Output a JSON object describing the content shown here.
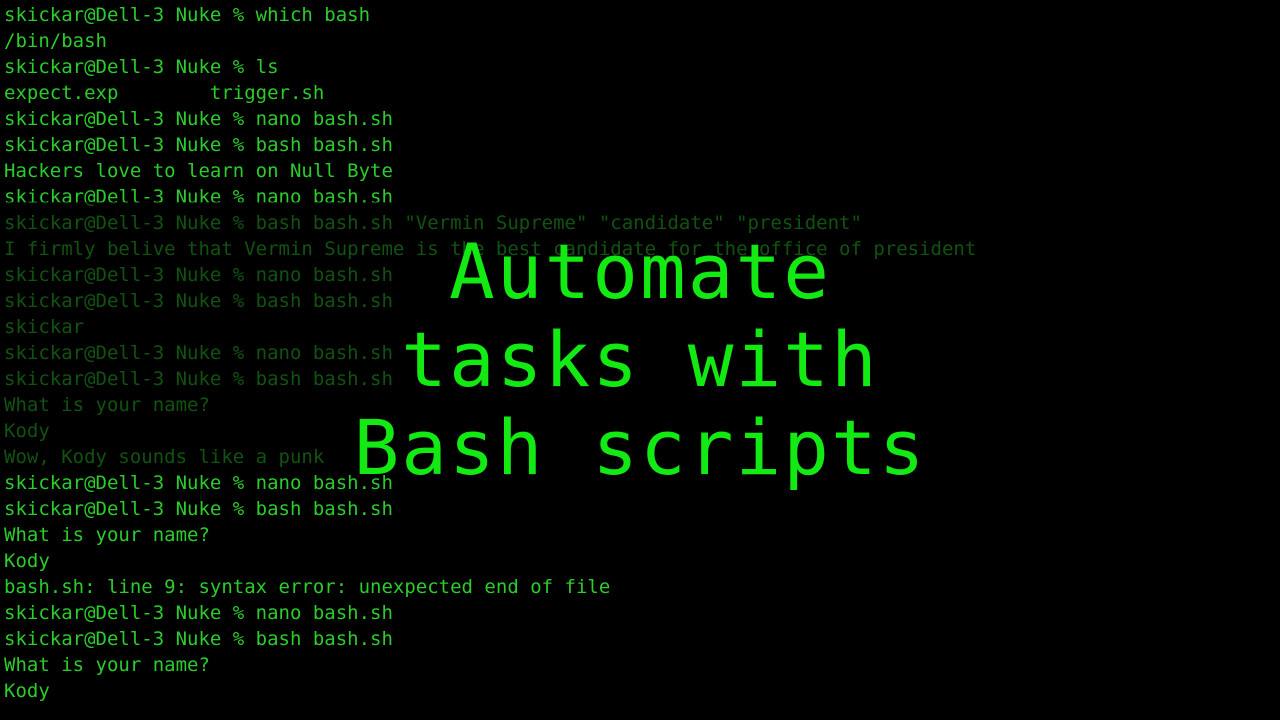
{
  "terminal": {
    "lines": [
      "skickar@Dell-3 Nuke % which bash",
      "/bin/bash",
      "skickar@Dell-3 Nuke % ls",
      "expect.exp        trigger.sh",
      "skickar@Dell-3 Nuke % nano bash.sh",
      "skickar@Dell-3 Nuke % bash bash.sh",
      "Hackers love to learn on Null Byte",
      "skickar@Dell-3 Nuke % nano bash.sh",
      "skickar@Dell-3 Nuke % bash bash.sh \"Vermin Supreme\" \"candidate\" \"president\"",
      "I firmly belive that Vermin Supreme is the best candidate for the office of president",
      "skickar@Dell-3 Nuke % nano bash.sh",
      "skickar@Dell-3 Nuke % bash bash.sh",
      "skickar",
      "skickar@Dell-3 Nuke % nano bash.sh",
      "skickar@Dell-3 Nuke % bash bash.sh",
      "What is your name?",
      "Kody",
      "Wow, Kody sounds like a punk",
      "skickar@Dell-3 Nuke % nano bash.sh",
      "skickar@Dell-3 Nuke % bash bash.sh",
      "What is your name?",
      "Kody",
      "bash.sh: line 9: syntax error: unexpected end of file",
      "skickar@Dell-3 Nuke % nano bash.sh",
      "skickar@Dell-3 Nuke % bash bash.sh",
      "What is your name?",
      "Kody"
    ]
  },
  "overlay": {
    "line1": "Automate",
    "line2": "tasks with",
    "line3": "Bash scripts"
  },
  "colors": {
    "background": "#000000",
    "terminal_text": "#2bcc2b",
    "overlay_text": "#13e913"
  }
}
